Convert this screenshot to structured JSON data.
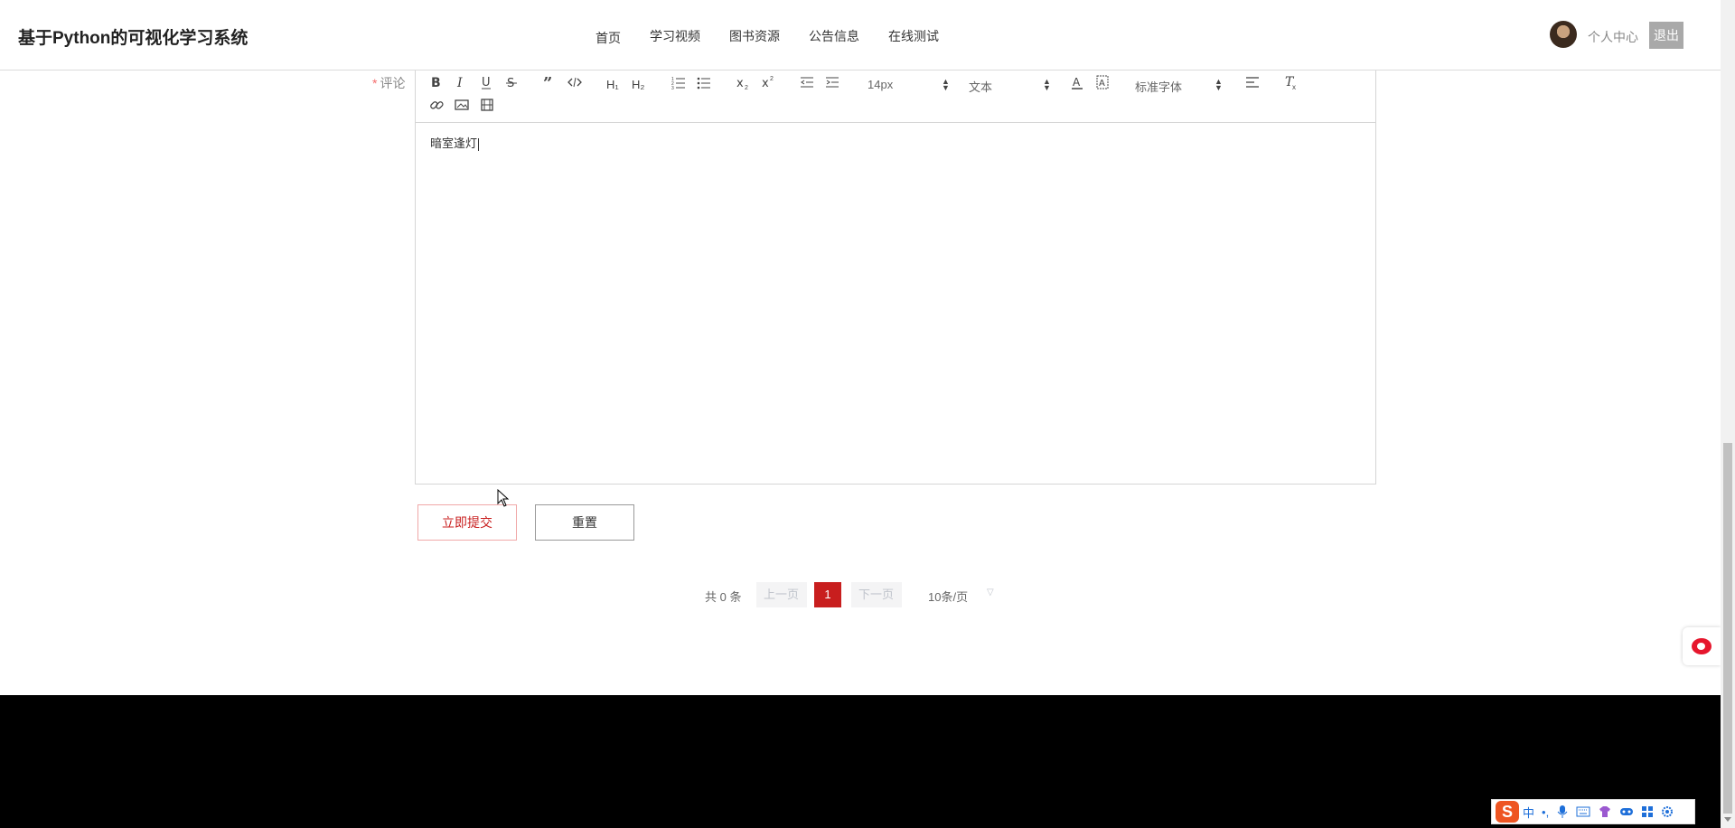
{
  "header": {
    "brand": "基于Python的可视化学习系统",
    "nav": [
      "首页",
      "学习视频",
      "图书资源",
      "公告信息",
      "在线测试"
    ],
    "user_center": "个人中心",
    "logout": "退出"
  },
  "form": {
    "required_mark": "*",
    "comment_label": "评论",
    "editor_content": "暗室逢灯",
    "submit_label": "立即提交",
    "reset_label": "重置"
  },
  "toolbar": {
    "font_size": "14px",
    "header_type": "文本",
    "font_family": "标准字体",
    "h1": "H₁",
    "h2": "H₂"
  },
  "pagination": {
    "total": "共 0 条",
    "prev": "上一页",
    "current": "1",
    "next": "下一页",
    "page_size": "10条/页"
  },
  "ime": {
    "logo": "S",
    "mode": "中",
    "punct": "•,"
  },
  "colors": {
    "accent": "#c81e1e",
    "footer": "#000000",
    "logout_bg": "#a9a9a9"
  },
  "icons": [
    "bold-icon",
    "italic-icon",
    "underline-icon",
    "strike-icon",
    "quote-icon",
    "code-icon",
    "ordered-list-icon",
    "bullet-list-icon",
    "subscript-icon",
    "superscript-icon",
    "outdent-icon",
    "indent-icon",
    "font-color-icon",
    "background-color-icon",
    "align-icon",
    "clear-format-icon",
    "link-icon",
    "image-icon",
    "video-icon",
    "weibo-icon",
    "ime-toolbar-icons"
  ]
}
